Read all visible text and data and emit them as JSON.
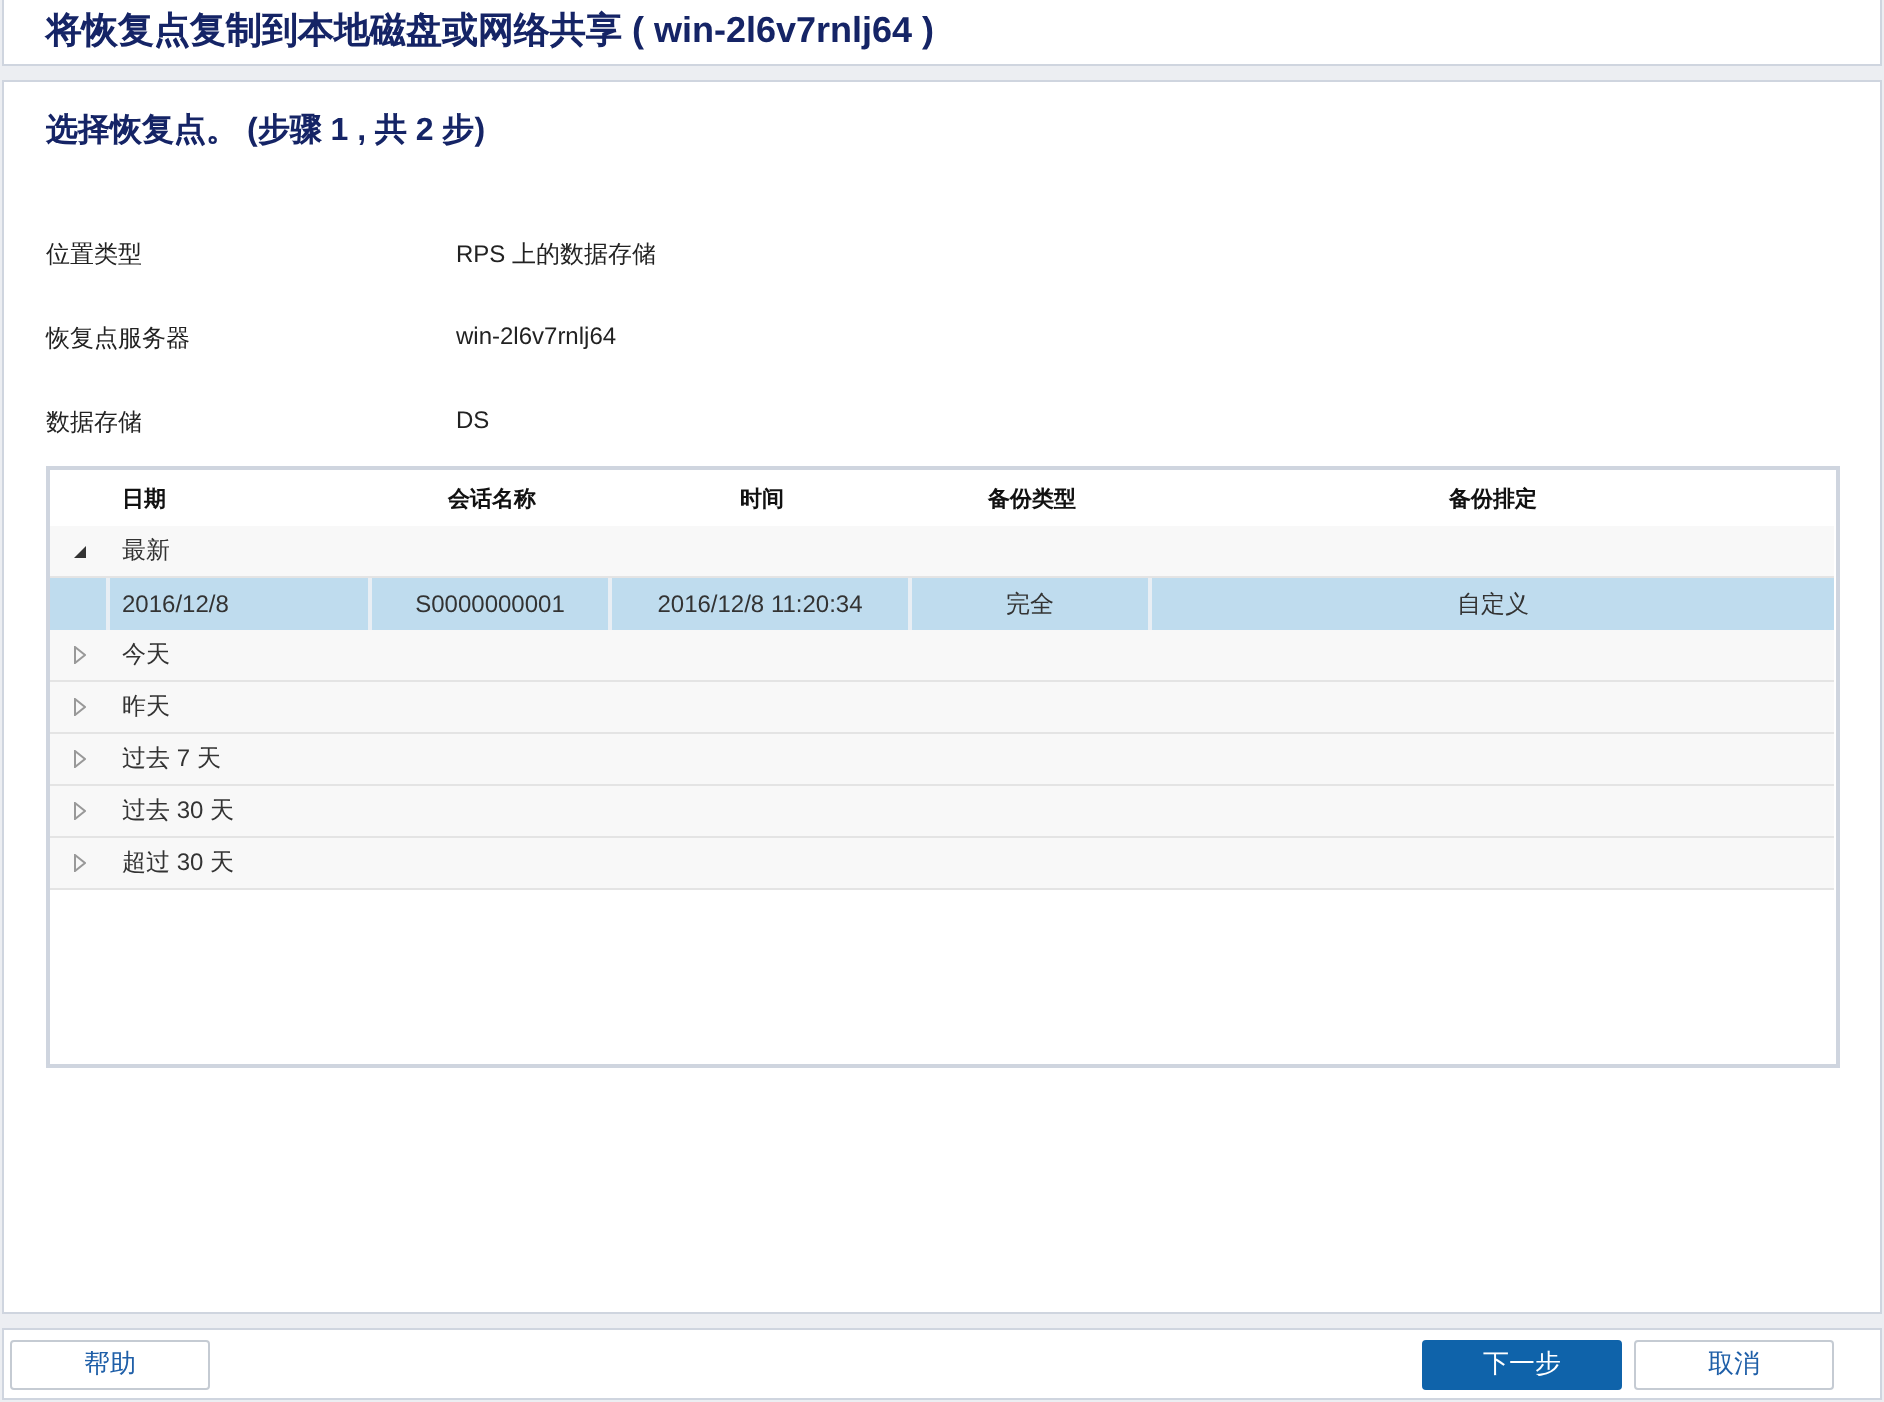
{
  "window": {
    "title": "将恢复点复制到本地磁盘或网络共享 ( win-2l6v7rnlj64 )"
  },
  "step_title": "选择恢复点。 (步骤 1 , 共 2 步)",
  "fields": [
    {
      "label": "位置类型",
      "value": "RPS 上的数据存储"
    },
    {
      "label": "恢复点服务器",
      "value": "win-2l6v7rnlj64"
    },
    {
      "label": "数据存储",
      "value": "DS"
    }
  ],
  "table": {
    "columns": [
      "日期",
      "会话名称",
      "时间",
      "备份类型",
      "备份排定"
    ],
    "groups": [
      {
        "label": "最新",
        "expanded": true,
        "rows": [
          {
            "cells": [
              "2016/12/8",
              "S0000000001",
              "2016/12/8 11:20:34",
              "完全",
              "自定义"
            ],
            "selected": true
          }
        ]
      },
      {
        "label": "今天",
        "expanded": false
      },
      {
        "label": "昨天",
        "expanded": false
      },
      {
        "label": "过去 7 天",
        "expanded": false
      },
      {
        "label": "过去 30 天",
        "expanded": false
      },
      {
        "label": "超过 30 天",
        "expanded": false
      }
    ]
  },
  "buttons": {
    "help": "帮助",
    "next": "下一步",
    "cancel": "取消"
  }
}
